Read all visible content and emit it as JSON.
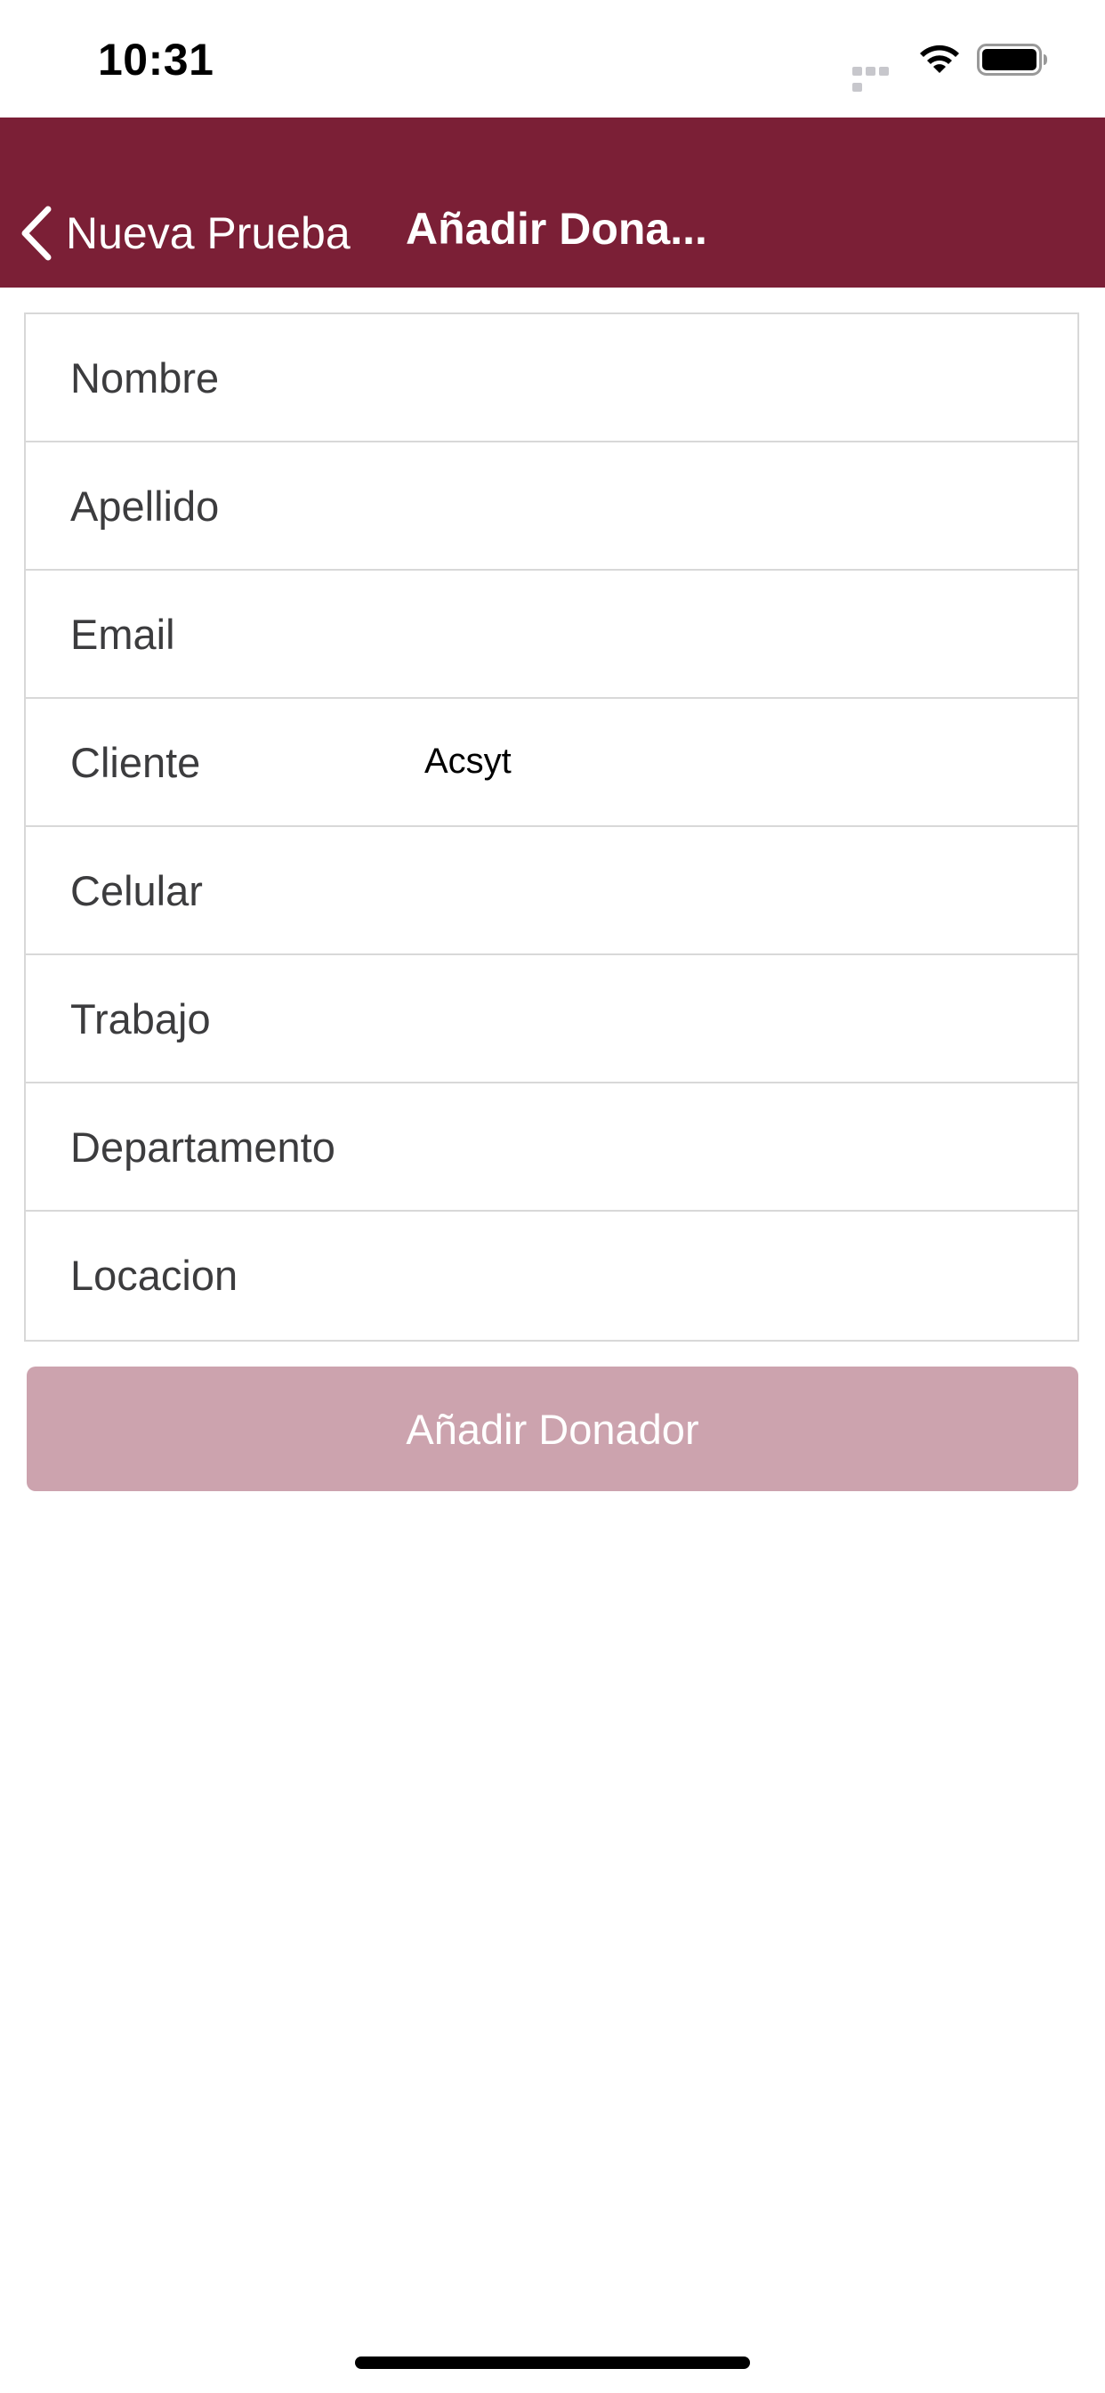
{
  "status_bar": {
    "time": "10:31",
    "icons": [
      "signal-icon",
      "wifi-icon",
      "battery-icon"
    ]
  },
  "nav": {
    "back_label": "Nueva Prueba",
    "back_icon": "chevron-left-icon",
    "title": "Añadir Dona..."
  },
  "form": {
    "fields": [
      {
        "label": "Nombre",
        "value": ""
      },
      {
        "label": "Apellido",
        "value": ""
      },
      {
        "label": "Email",
        "value": ""
      },
      {
        "label": "Cliente",
        "value": "Acsyt"
      },
      {
        "label": "Celular",
        "value": ""
      },
      {
        "label": "Trabajo",
        "value": ""
      },
      {
        "label": "Departamento",
        "value": ""
      },
      {
        "label": "Locacion",
        "value": ""
      }
    ]
  },
  "submit": {
    "label": "Añadir Donador"
  },
  "colors": {
    "nav_background": "#7b1f36",
    "button_background": "#cca3ae",
    "button_text": "#ffffff",
    "border": "#d8d8d8"
  }
}
